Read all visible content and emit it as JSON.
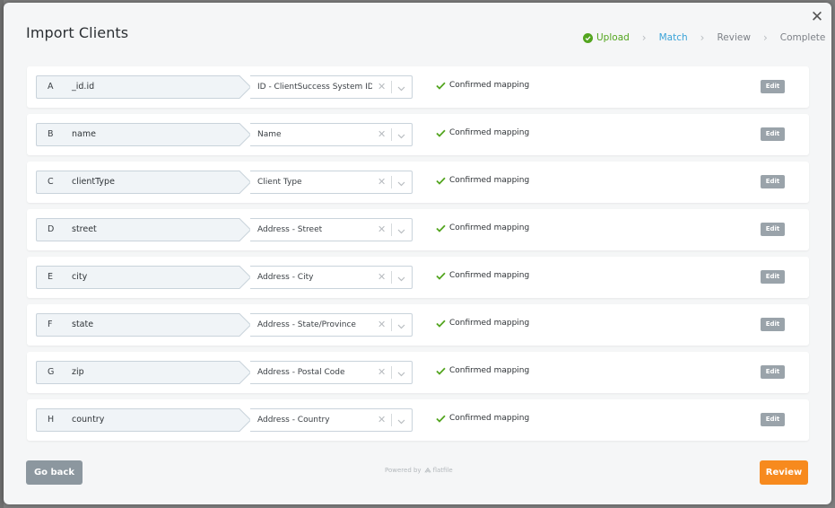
{
  "dialog": {
    "title": "Import Clients",
    "close_icon": "close-icon"
  },
  "steps": [
    {
      "label": "Upload",
      "state": "done",
      "color": "#53a51f"
    },
    {
      "label": "Match",
      "state": "active",
      "color": "#3aa3d8"
    },
    {
      "label": "Review",
      "state": "pending",
      "color": "#7d8187"
    },
    {
      "label": "Complete",
      "state": "pending",
      "color": "#7d8187"
    }
  ],
  "mappings": [
    {
      "letter": "A",
      "source": "_id.id",
      "target": "ID - ClientSuccess System ID [...",
      "status": "Confirmed mapping",
      "edit": "Edit"
    },
    {
      "letter": "B",
      "source": "name",
      "target": "Name",
      "status": "Confirmed mapping",
      "edit": "Edit"
    },
    {
      "letter": "C",
      "source": "clientType",
      "target": "Client Type",
      "status": "Confirmed mapping",
      "edit": "Edit"
    },
    {
      "letter": "D",
      "source": "street",
      "target": "Address - Street",
      "status": "Confirmed mapping",
      "edit": "Edit"
    },
    {
      "letter": "E",
      "source": "city",
      "target": "Address - City",
      "status": "Confirmed mapping",
      "edit": "Edit"
    },
    {
      "letter": "F",
      "source": "state",
      "target": "Address - State/Province",
      "status": "Confirmed mapping",
      "edit": "Edit"
    },
    {
      "letter": "G",
      "source": "zip",
      "target": "Address - Postal Code",
      "status": "Confirmed mapping",
      "edit": "Edit"
    },
    {
      "letter": "H",
      "source": "country",
      "target": "Address - Country",
      "status": "Confirmed mapping",
      "edit": "Edit"
    }
  ],
  "footer": {
    "back_label": "Go back",
    "powered_by": "Powered by",
    "brand": "flatfile",
    "review_label": "Review"
  },
  "colors": {
    "success": "#53a51f",
    "active": "#3aa3d8",
    "primary_button": "#f78a1e",
    "secondary_button": "#8c979f"
  }
}
